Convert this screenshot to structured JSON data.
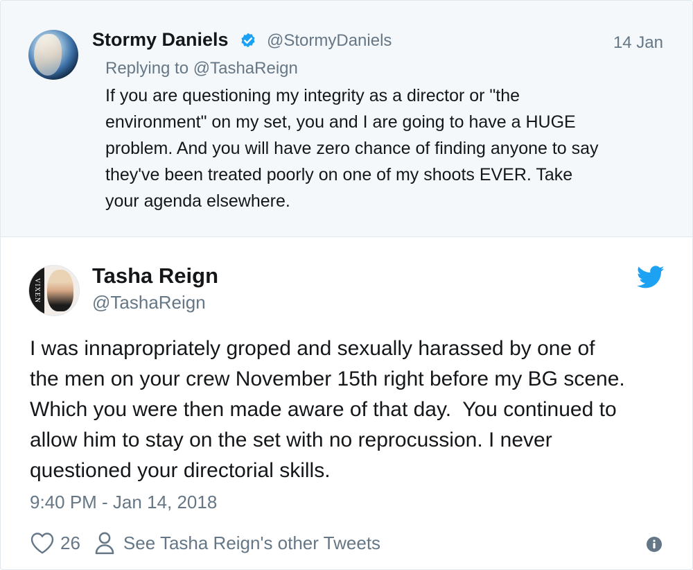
{
  "colors": {
    "background": "#ffffff",
    "parent_background": "#f5f8fa",
    "text_primary": "#14171a",
    "text_secondary": "#657786",
    "twitter_blue": "#1da1f2",
    "border": "#e1e8ed"
  },
  "parent_tweet": {
    "author_name": "Stormy Daniels",
    "verified": true,
    "handle": "@StormyDaniels",
    "date": "14 Jan",
    "replying_prefix": "Replying to ",
    "replying_to": "@TashaReign",
    "text_lines": [
      "If you are questioning my integrity as a director or \"the",
      "environment\" on my set, you and I are going to have a HUGE",
      "problem. And you will have zero chance of finding anyone to say",
      "they've been treated poorly on one of my shoots EVER. Take",
      "your agenda elsewhere."
    ],
    "icons": {
      "avatar": "avatar-photo",
      "verified": "verified-badge-icon"
    }
  },
  "tweet": {
    "author_name": "Tasha Reign",
    "handle": "@TashaReign",
    "avatar_band_text": "VIXEN",
    "text_lines": [
      "I was innapropriately groped and sexually harassed by one of",
      "the men on your crew November 15th right before my BG scene.",
      "Which you were then made aware of that day.  You continued to",
      "allow him to stay on the set with no reprocussion. I never",
      "questioned your directorial skills."
    ],
    "timestamp": "9:40 PM - Jan 14, 2018",
    "like_count": "26",
    "other_tweets_label": "See Tasha Reign's other Tweets",
    "icons": {
      "brand": "twitter-bird-icon",
      "like": "heart-icon",
      "profile": "person-icon",
      "info": "info-icon"
    }
  }
}
